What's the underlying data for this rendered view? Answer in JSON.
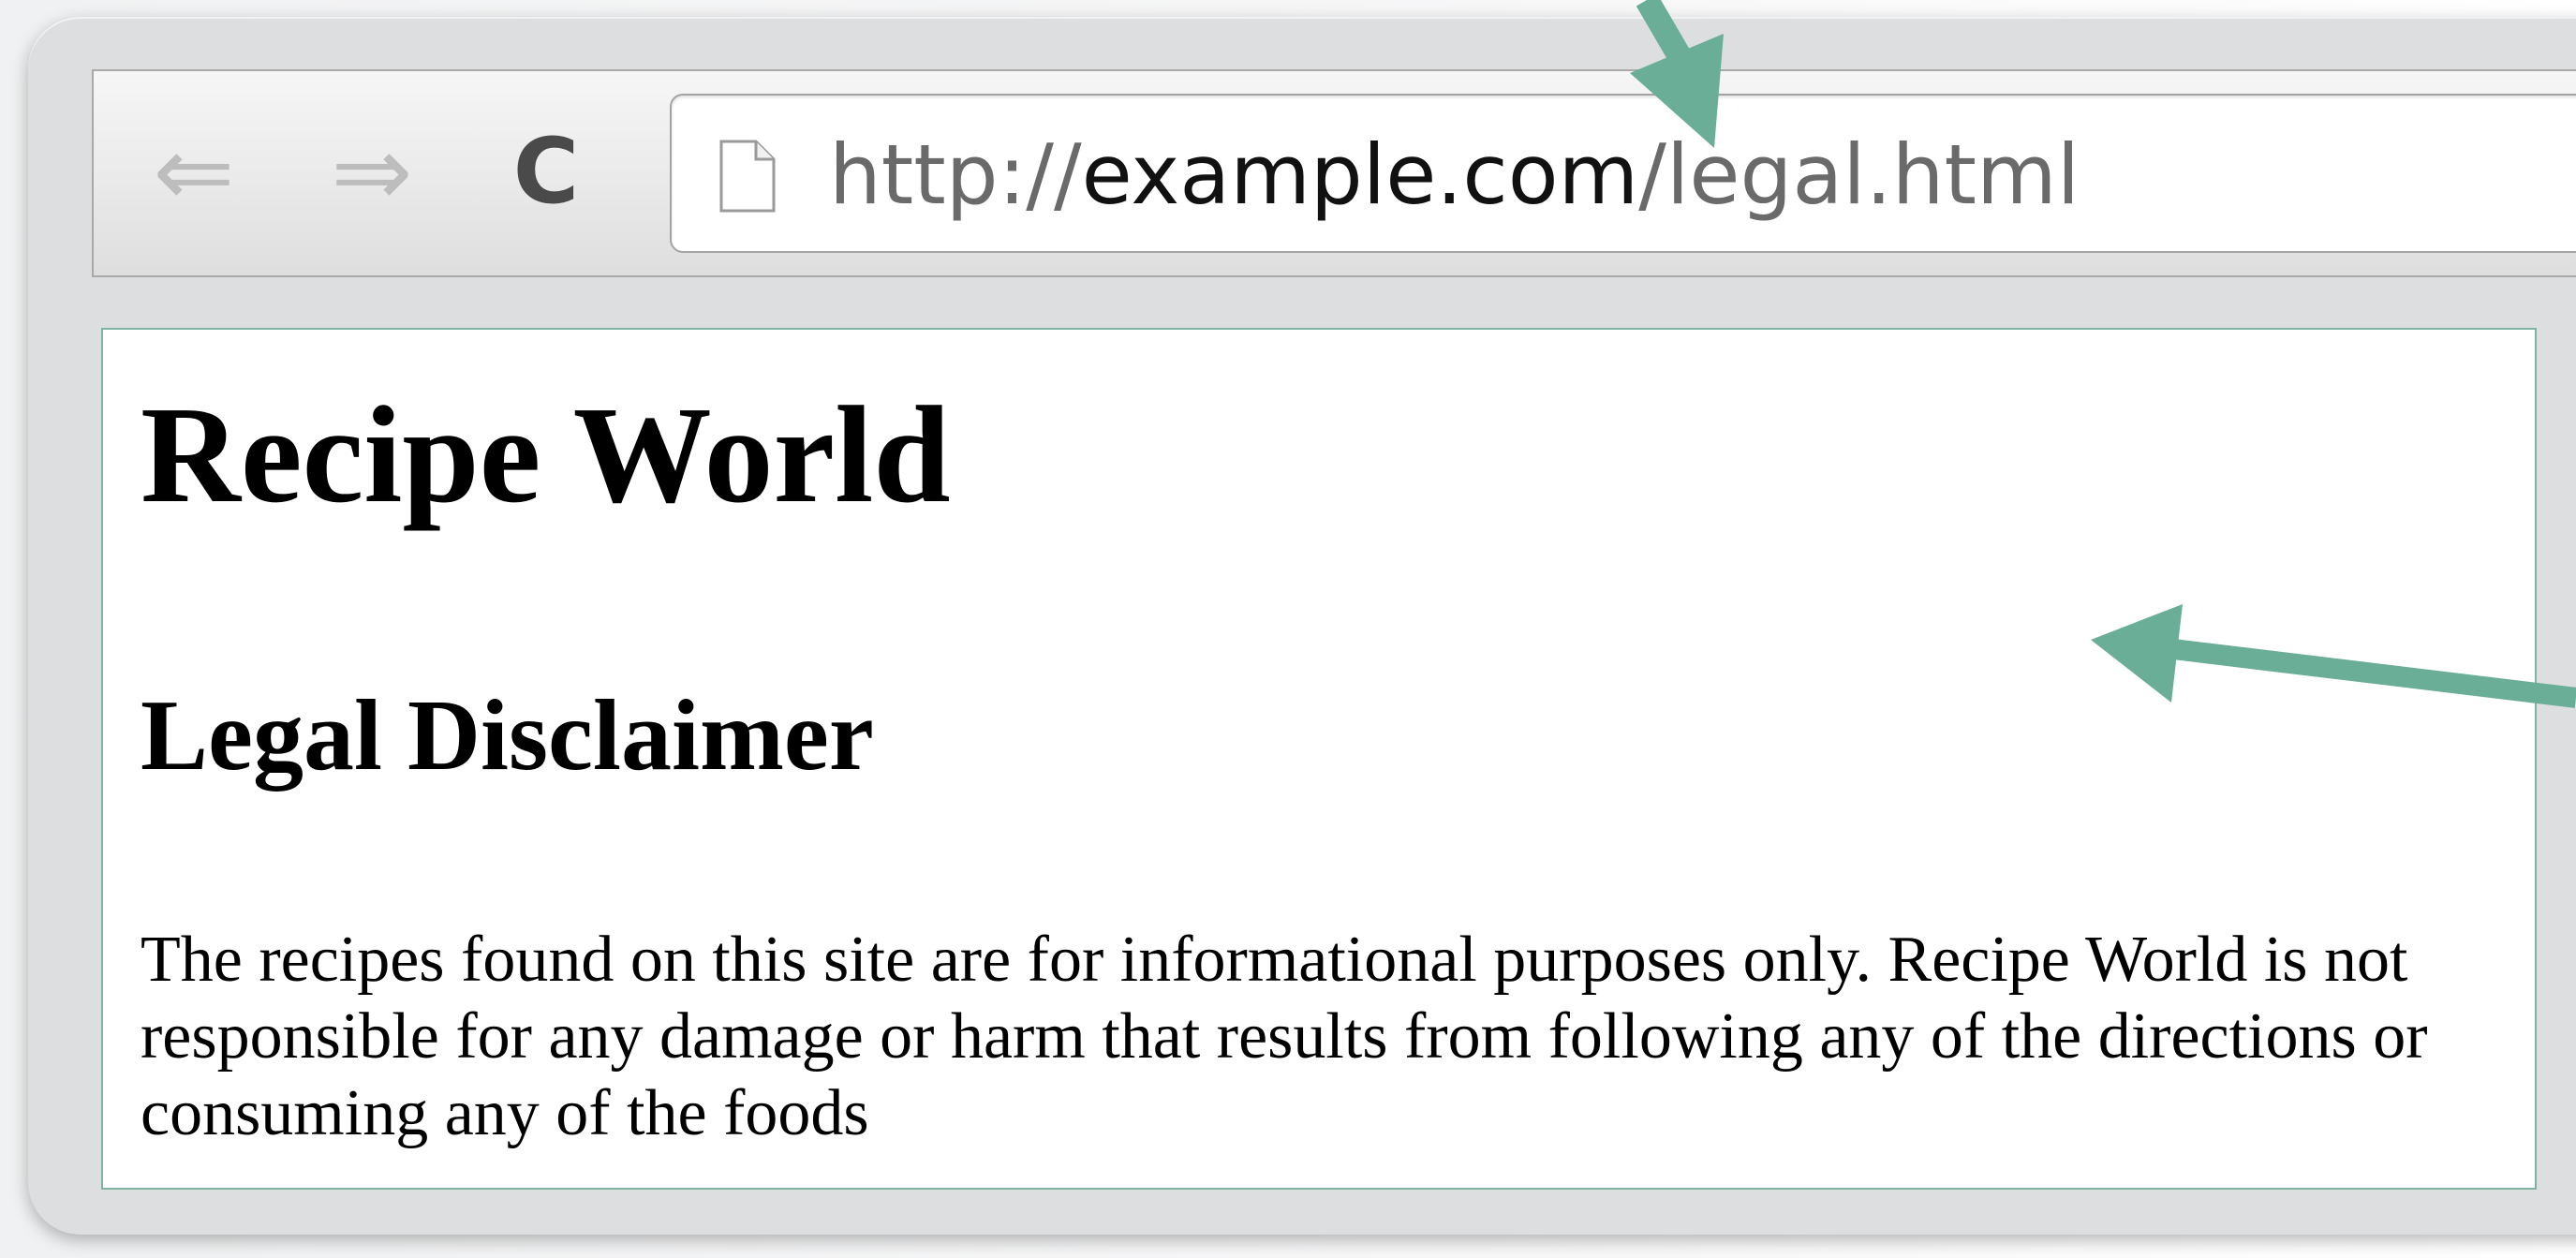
{
  "browser": {
    "nav": {
      "back_glyph": "⇐",
      "forward_glyph": "⇒",
      "reload_glyph": "C"
    },
    "address_bar": {
      "scheme": "http://",
      "host": "example.com",
      "path": "/legal.html"
    },
    "icons": [
      "back-arrow-icon",
      "forward-arrow-icon",
      "reload-icon",
      "page-document-icon"
    ]
  },
  "page": {
    "site_title": "Recipe World",
    "section_title": "Legal Disclaimer",
    "body": "The recipes found on this site are for informational purposes only. Recipe World is not responsible for any damage or harm that results from following any of the directions or consuming any of the foods"
  },
  "colors": {
    "annotation_arrow": "#6aae97",
    "content_border": "#7fb4a2"
  }
}
